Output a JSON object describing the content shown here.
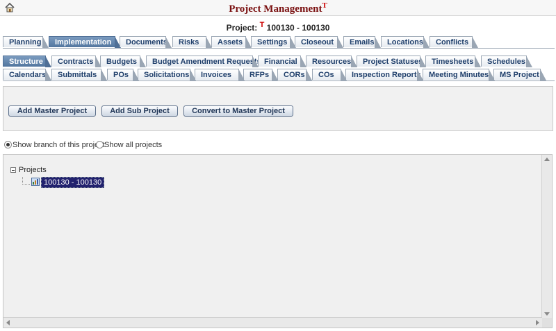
{
  "header": {
    "title": "Project Management",
    "title_mark": "T",
    "project_prefix": "Project:",
    "project_mark": "T",
    "project_id": "100130 - 100130"
  },
  "tabs_main": [
    {
      "label": "Planning",
      "active": false
    },
    {
      "label": "Implementation",
      "active": true
    },
    {
      "label": "Documents",
      "active": false
    },
    {
      "label": "Risks",
      "active": false
    },
    {
      "label": "Assets",
      "active": false
    },
    {
      "label": "Settings",
      "active": false
    },
    {
      "label": "Closeout",
      "active": false
    },
    {
      "label": "Emails",
      "active": false
    },
    {
      "label": "Locations",
      "active": false
    },
    {
      "label": "Conflicts",
      "active": false
    }
  ],
  "tabs_sub1": [
    {
      "label": "Structure",
      "active": true
    },
    {
      "label": "Contracts",
      "active": false
    },
    {
      "label": "Budgets",
      "active": false
    },
    {
      "label": "Budget Amendment Requests",
      "active": false
    },
    {
      "label": "Financial",
      "active": false
    },
    {
      "label": "Resources",
      "active": false
    },
    {
      "label": "Project Statuses",
      "active": false
    },
    {
      "label": "Timesheets",
      "active": false
    },
    {
      "label": "Schedules",
      "active": false
    }
  ],
  "tabs_sub2": [
    {
      "label": "Calendars",
      "active": false
    },
    {
      "label": "Submittals",
      "active": false
    },
    {
      "label": "POs",
      "active": false
    },
    {
      "label": "Solicitations",
      "active": false
    },
    {
      "label": "Invoices",
      "active": false
    },
    {
      "label": "RFPs",
      "active": false
    },
    {
      "label": "CORs",
      "active": false
    },
    {
      "label": "COs",
      "active": false
    },
    {
      "label": "Inspection Reports",
      "active": false
    },
    {
      "label": "Meeting Minutes",
      "active": false
    },
    {
      "label": "MS Project",
      "active": false
    }
  ],
  "toolbar": {
    "add_master": "Add Master Project",
    "add_sub": "Add Sub Project",
    "convert": "Convert to Master Project"
  },
  "filters": {
    "show_branch": "Show branch of this project",
    "show_all": "Show all projects",
    "selected": "show_branch"
  },
  "tree": {
    "root_label": "Projects",
    "node_label": "100130 - 100130"
  },
  "colors": {
    "title": "#7a1010",
    "active_tab": "#52769f",
    "selection": "#22226e"
  }
}
